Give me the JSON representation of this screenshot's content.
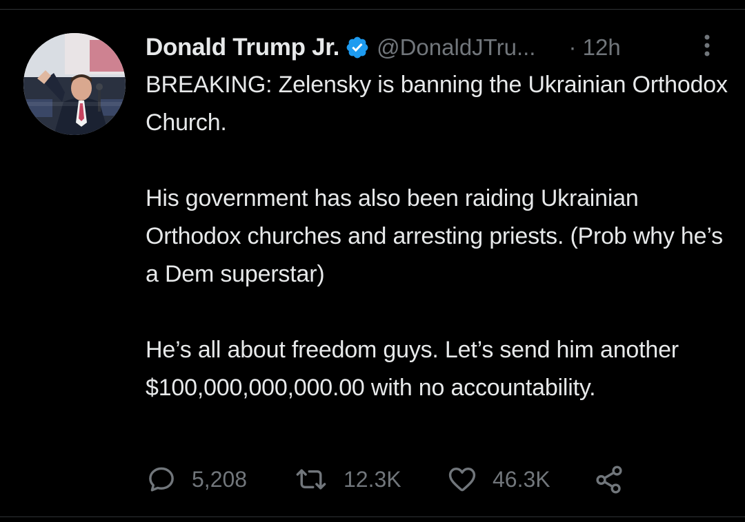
{
  "tweet": {
    "author": {
      "display_name": "Donald Trump Jr.",
      "handle": "@DonaldJTru...",
      "verified": true,
      "avatar": "avatar-photo"
    },
    "time": "· 12h",
    "paragraphs": [
      "BREAKING: Zelensky is banning the Ukrainian Orthodox Church.",
      "His government has also been raiding Ukrainian Orthodox churches and arresting priests. (Prob why he’s a Dem superstar)",
      "He’s all about freedom guys. Let’s send him another $100,000,000,000.00 with no accountability."
    ],
    "stats": {
      "replies": "5,208",
      "retweets": "12.3K",
      "likes": "46.3K"
    }
  },
  "icons": {
    "verified": "verified-badge-icon",
    "more": "more-vertical-icon",
    "reply": "reply-icon",
    "retweet": "retweet-icon",
    "like": "heart-icon",
    "share": "share-icon"
  },
  "colors": {
    "background": "#000000",
    "text_primary": "#e7e9ea",
    "text_secondary": "#71767b",
    "verified_blue": "#1d9bf0",
    "divider": "#2f3336"
  }
}
